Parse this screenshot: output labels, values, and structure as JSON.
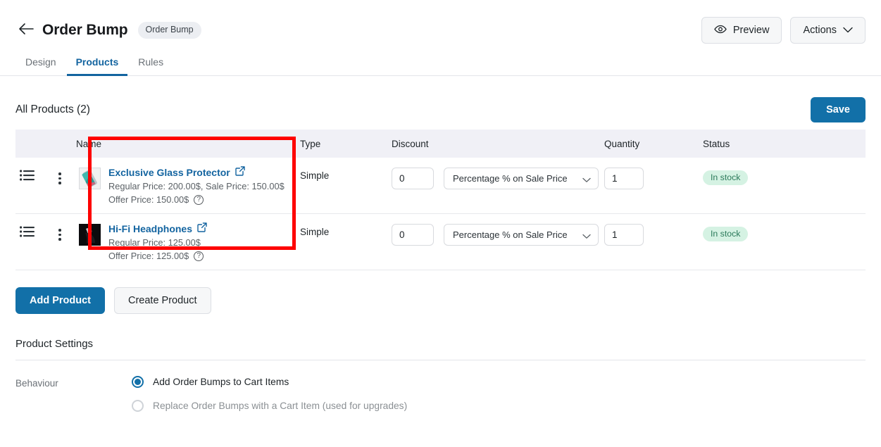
{
  "header": {
    "back_icon": "arrow-left-icon",
    "title": "Order Bump",
    "badge": "Order Bump",
    "preview_label": "Preview",
    "preview_icon": "eye-icon",
    "actions_label": "Actions",
    "actions_icon": "chevron-down-icon"
  },
  "tabs": [
    {
      "label": "Design",
      "active": false
    },
    {
      "label": "Products",
      "active": true
    },
    {
      "label": "Rules",
      "active": false
    }
  ],
  "products_section": {
    "title": "All Products (2)",
    "save_label": "Save"
  },
  "table": {
    "columns": [
      "",
      "",
      "Name",
      "Type",
      "Discount",
      "Quantity",
      "Status"
    ],
    "rows": [
      {
        "drag_icon": "list-reorder-icon",
        "kebab_icon": "kebab-menu-icon",
        "thumbnail": "glass-protector-thumbnail",
        "name": "Exclusive Glass Protector",
        "external_link_icon": "external-link-icon",
        "price_line_1": "Regular Price: 200.00$, Sale Price: 150.00$",
        "price_line_2": "Offer Price: 150.00$",
        "help_icon": "help-circle-icon",
        "type": "Simple",
        "discount_value": "0",
        "discount_mode": "Percentage % on Sale Price",
        "quantity": "1",
        "status": "In stock"
      },
      {
        "drag_icon": "list-reorder-icon",
        "kebab_icon": "kebab-menu-icon",
        "thumbnail": "headphones-thumbnail",
        "name": "Hi-Fi Headphones",
        "external_link_icon": "external-link-icon",
        "price_line_1": "Regular Price: 125.00$",
        "price_line_2": "Offer Price: 125.00$",
        "help_icon": "help-circle-icon",
        "type": "Simple",
        "discount_value": "0",
        "discount_mode": "Percentage % on Sale Price",
        "quantity": "1",
        "status": "In stock"
      }
    ]
  },
  "actions": {
    "add_product_label": "Add Product",
    "create_product_label": "Create Product"
  },
  "product_settings": {
    "title": "Product Settings",
    "behaviour_label": "Behaviour",
    "options": [
      {
        "label": "Add Order Bumps to Cart Items",
        "selected": true
      },
      {
        "label": "Replace Order Bumps with a Cart Item (used for upgrades)",
        "selected": false
      }
    ]
  },
  "annotation": {
    "highlight_color": "#fe0000",
    "target": "product-name-column"
  },
  "colors": {
    "accent": "#1270a8",
    "link": "#1364a0",
    "header_bg": "#f0f0f6",
    "status_bg": "#d5f2e3",
    "status_text": "#2b7a5a"
  }
}
